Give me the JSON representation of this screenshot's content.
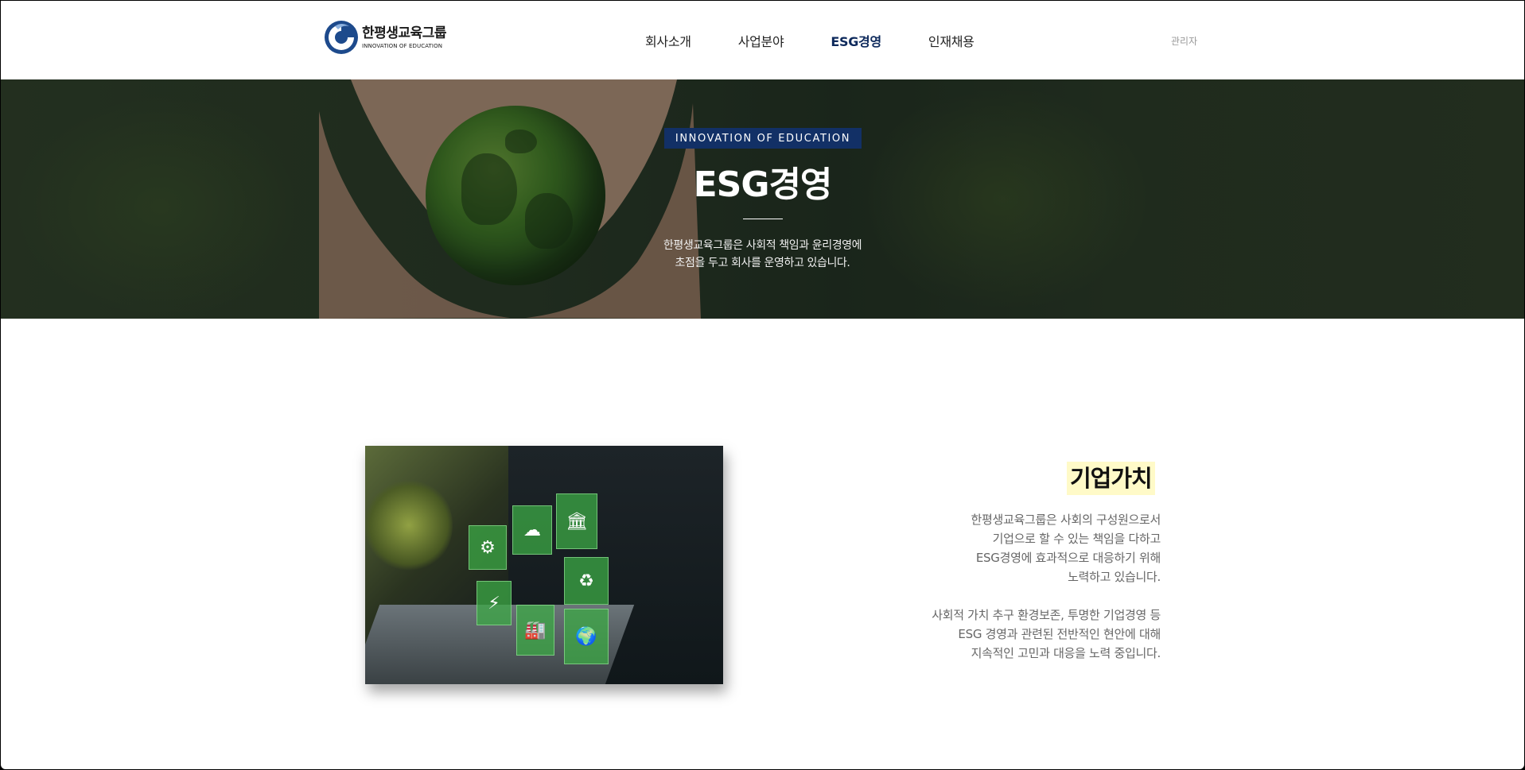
{
  "header": {
    "logo_name": "한평생교육그룹",
    "logo_sub": "INNOVATION OF EDUCATION",
    "nav": [
      "회사소개",
      "사업분야",
      "ESG경영",
      "인재채용"
    ],
    "active_nav": "ESG경영",
    "admin_label": "관리자"
  },
  "hero": {
    "tag": "INNOVATION OF EDUCATION",
    "title": "ESG경영",
    "desc_line1": "한평생교육그룹은 사회적 책임과 윤리경영에",
    "desc_line2": "초점을 두고 회사를 운영하고 있습니다."
  },
  "content": {
    "title": "기업가치",
    "para1": [
      "한평생교육그룹은 사회의 구성원으로서",
      "기업으로 할 수 있는 책임을 다하고",
      "ESG경영에 효과적으로 대응하기 위해",
      "노력하고 있습니다."
    ],
    "para2": [
      "사회적 가치 추구 환경보존, 투명한 기업경영 등",
      "ESG 경영과 관련된 전반적인 현안에 대해",
      "지속적인 고민과 대응을 노력 중입니다."
    ]
  },
  "colors": {
    "brand_navy": "#123066",
    "title_highlight": "#fffac8"
  }
}
